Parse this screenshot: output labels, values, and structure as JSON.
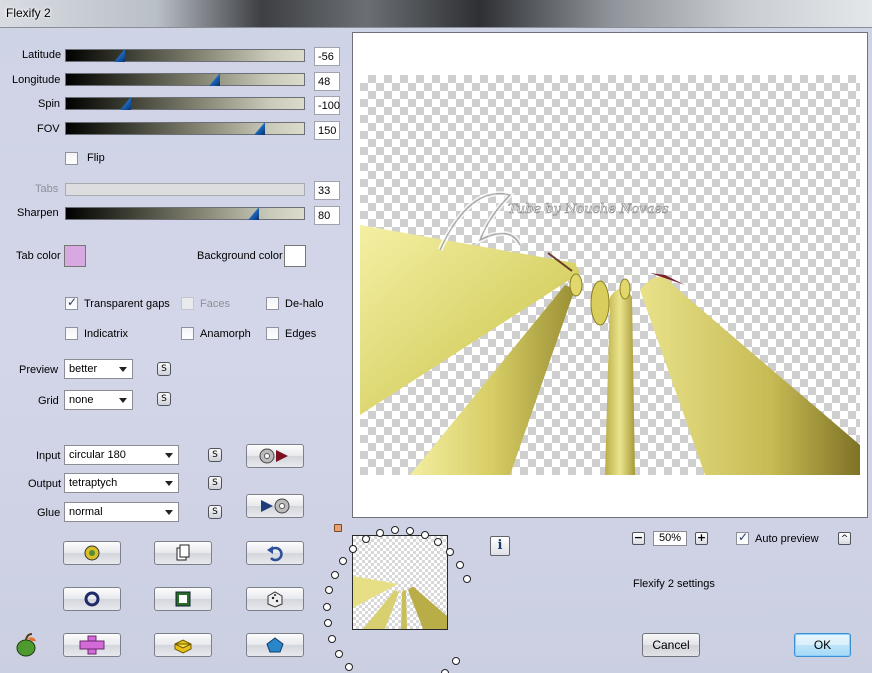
{
  "window": {
    "title": "Flexify 2"
  },
  "sliders": {
    "latitude": {
      "label": "Latitude",
      "value": "-56",
      "fraction": 0.21
    },
    "longitude": {
      "label": "Longitude",
      "value": "48",
      "fraction": 0.63
    },
    "spin": {
      "label": "Spin",
      "value": "-100",
      "fraction": 0.24
    },
    "fov": {
      "label": "FOV",
      "value": "150",
      "fraction": 0.83
    },
    "tabs": {
      "label": "Tabs",
      "value": "33",
      "fraction": 0.33,
      "disabled": true
    },
    "sharpen": {
      "label": "Sharpen",
      "value": "80",
      "fraction": 0.8
    }
  },
  "flip": {
    "label": "Flip",
    "checked": false
  },
  "colors": {
    "tab_color": {
      "label": "Tab color",
      "value": "#d8a8e0"
    },
    "background_color": {
      "label": "Background color",
      "value": "#ffffff"
    }
  },
  "options": {
    "transparent_gaps": {
      "label": "Transparent gaps",
      "checked": true
    },
    "faces": {
      "label": "Faces",
      "checked": false,
      "disabled": true
    },
    "de_halo": {
      "label": "De-halo",
      "checked": false
    },
    "indicatrix": {
      "label": "Indicatrix",
      "checked": false
    },
    "anamorph": {
      "label": "Anamorph",
      "checked": false
    },
    "edges": {
      "label": "Edges",
      "checked": false
    }
  },
  "selects": {
    "preview": {
      "label": "Preview",
      "value": "better"
    },
    "grid": {
      "label": "Grid",
      "value": "none"
    },
    "input": {
      "label": "Input",
      "value": "circular 180"
    },
    "output": {
      "label": "Output",
      "value": "tetraptych"
    },
    "glue": {
      "label": "Glue",
      "value": "normal"
    }
  },
  "s_button_glyph": "S",
  "preview": {
    "watermark": "Tube by Nouche Novaes",
    "zoom": "50%",
    "zoom_minus": "−",
    "zoom_plus": "+",
    "auto_preview": {
      "label": "Auto preview",
      "checked": true
    },
    "info_glyph": "i",
    "up_glyph": "^"
  },
  "settings_caption": "Flexify 2 settings",
  "buttons": {
    "cancel": "Cancel",
    "ok": "OK"
  },
  "accent_colors": {
    "slider_thumb": "#1b64b8",
    "ok_border": "#3d8fd3",
    "cone_yellow": "#e8e38a"
  }
}
